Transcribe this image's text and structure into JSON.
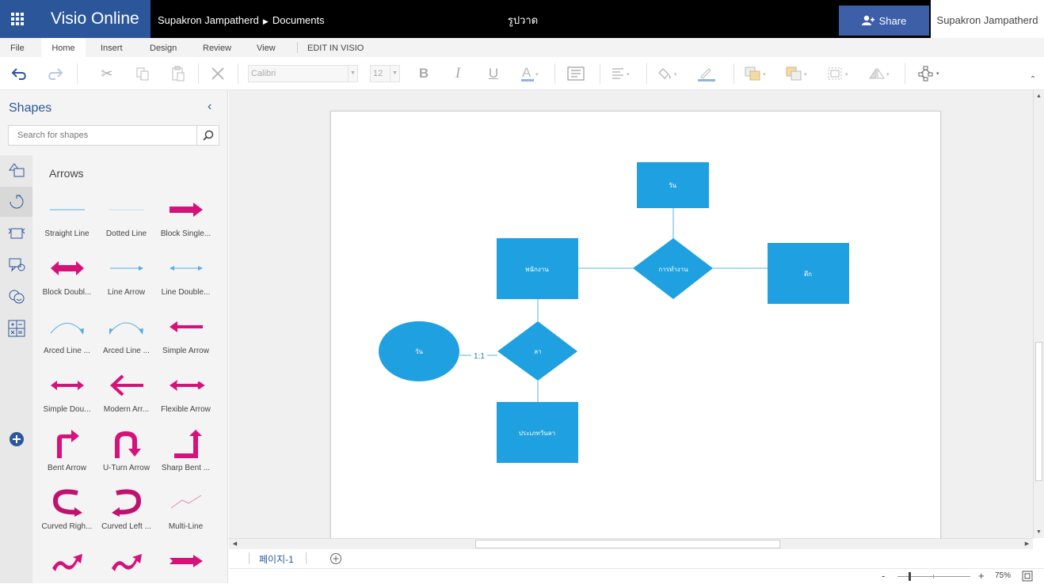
{
  "topbar": {
    "app_name": "Visio Online",
    "breadcrumb_owner": "Supakron Jampatherd",
    "breadcrumb_folder": "Documents",
    "doc_title": "รูปวาด",
    "share_label": "Share",
    "user_name": "Supakron Jampatherd"
  },
  "ribbon": {
    "tabs": [
      "File",
      "Home",
      "Insert",
      "Design",
      "Review",
      "View",
      "EDIT IN VISIO"
    ],
    "active_tab": "Home",
    "font_name": "Calibri",
    "font_size": "12"
  },
  "shapes_panel": {
    "title": "Shapes",
    "search_placeholder": "Search for shapes",
    "stencil_title": "Arrows",
    "items": [
      {
        "label": "Straight Line",
        "icon": "straight-line"
      },
      {
        "label": "Dotted Line",
        "icon": "dotted-line"
      },
      {
        "label": "Block Single...",
        "icon": "block-single-arrow"
      },
      {
        "label": "Block Doubl...",
        "icon": "block-double-arrow"
      },
      {
        "label": "Line Arrow",
        "icon": "line-arrow"
      },
      {
        "label": "Line Double...",
        "icon": "line-double-arrow"
      },
      {
        "label": "Arced Line ...",
        "icon": "arced-line-arrow"
      },
      {
        "label": "Arced Line ...",
        "icon": "arced-line-double"
      },
      {
        "label": "Simple Arrow",
        "icon": "simple-arrow"
      },
      {
        "label": "Simple Dou...",
        "icon": "simple-double-arrow"
      },
      {
        "label": "Modern Arr...",
        "icon": "modern-arrow"
      },
      {
        "label": "Flexible Arrow",
        "icon": "flexible-arrow"
      },
      {
        "label": "Bent Arrow",
        "icon": "bent-arrow"
      },
      {
        "label": "U-Turn Arrow",
        "icon": "u-turn-arrow"
      },
      {
        "label": "Sharp Bent ...",
        "icon": "sharp-bent-arrow"
      },
      {
        "label": "Curved Righ...",
        "icon": "curved-right-arrow"
      },
      {
        "label": "Curved Left ...",
        "icon": "curved-left-arrow"
      },
      {
        "label": "Multi-Line",
        "icon": "multi-line"
      }
    ]
  },
  "diagram": {
    "accent_color": "#1fa0e0",
    "shapes": [
      {
        "id": "top-rect",
        "type": "rectangle",
        "label": "วัน"
      },
      {
        "id": "employee-rect",
        "type": "rectangle",
        "label": "พนักงาน"
      },
      {
        "id": "work-diamond",
        "type": "diamond",
        "label": "การทำงาน"
      },
      {
        "id": "right-rect",
        "type": "rectangle",
        "label": "ตึก"
      },
      {
        "id": "day-ellipse",
        "type": "ellipse",
        "label": "วัน"
      },
      {
        "id": "leave-diamond",
        "type": "diamond",
        "label": "ลา"
      },
      {
        "id": "leave-type-rect",
        "type": "rectangle",
        "label": "ประเภทวันลา"
      }
    ],
    "connector_label": "1:1"
  },
  "status": {
    "page_tab": "페이지-1",
    "zoom_minus": "-",
    "zoom_plus": "+",
    "zoom_level": "75%"
  }
}
